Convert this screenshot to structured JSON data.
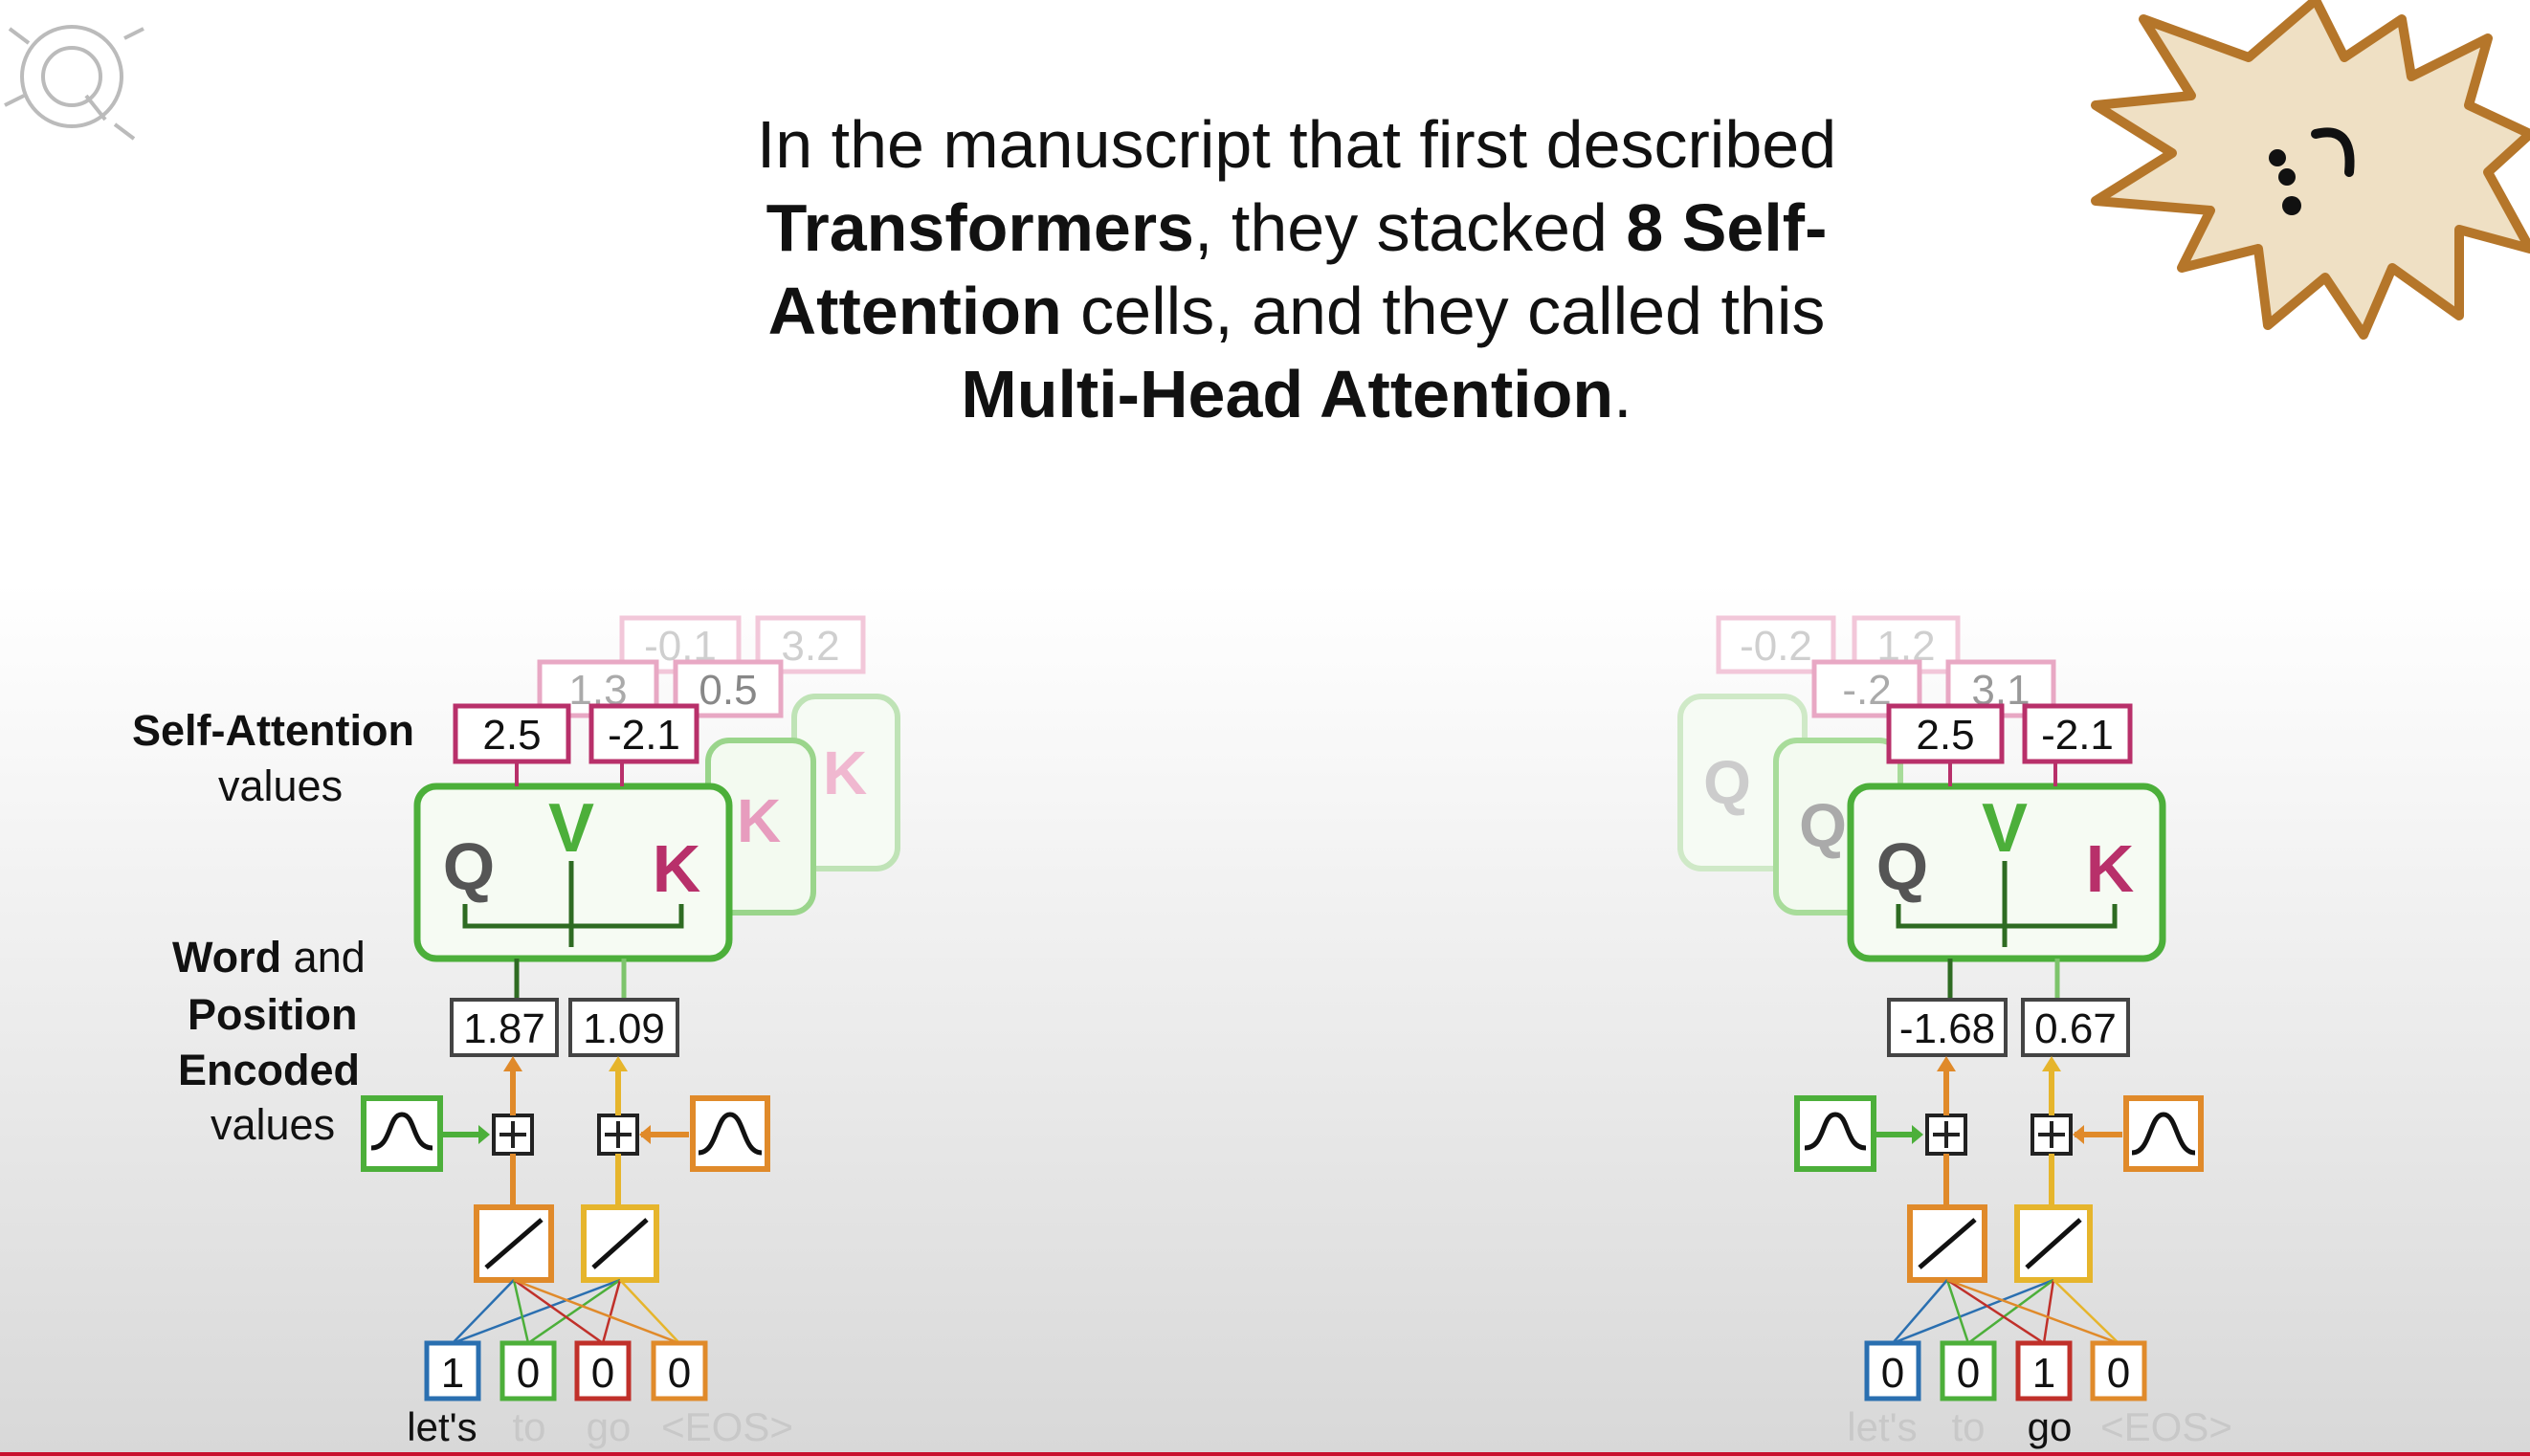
{
  "caption": {
    "line1": "In the manuscript that first described",
    "line2_bold1": "Transformers",
    "line2_mid": ", they stacked ",
    "line2_bold2": "8 Self-",
    "line3_bold": "Attention",
    "line3_rest": " cells, and they called this",
    "line4_bold": "Multi-Head Attention",
    "line4_rest": "."
  },
  "left_labels": {
    "self_attention": "Self-Attention",
    "values": "values",
    "word": "Word",
    "and": "and",
    "position": "Position",
    "encoded": "Encoded",
    "values2": "values"
  },
  "cell_letters": {
    "q": "Q",
    "v": "V",
    "k": "K"
  },
  "left": {
    "back_values_2": [
      "-0.1",
      "3.2"
    ],
    "back_values_1": [
      "1.3",
      "0.5"
    ],
    "attention_values": [
      "2.5",
      "-2.1"
    ],
    "encoded_values": [
      "1.87",
      "1.09"
    ],
    "one_hot": [
      "1",
      "0",
      "0",
      "0"
    ],
    "tokens": [
      "let's",
      "to",
      "go",
      "<EOS>"
    ]
  },
  "right": {
    "back_values_2": [
      "-0.2",
      "1.2"
    ],
    "back_values_1": [
      "-.2",
      "3.1"
    ],
    "attention_values": [
      "2.5",
      "-2.1"
    ],
    "encoded_values": [
      "-1.68",
      "0.67"
    ],
    "one_hot": [
      "0",
      "0",
      "1",
      "0"
    ],
    "tokens": [
      "let's",
      "to",
      "go",
      "<EOS>"
    ]
  },
  "colors": {
    "green": "#4caf3a",
    "magenta": "#b8306a",
    "orange": "#e08a2a",
    "blue": "#2a6fb0",
    "red": "#c0302a",
    "brown": "#b5762a"
  }
}
